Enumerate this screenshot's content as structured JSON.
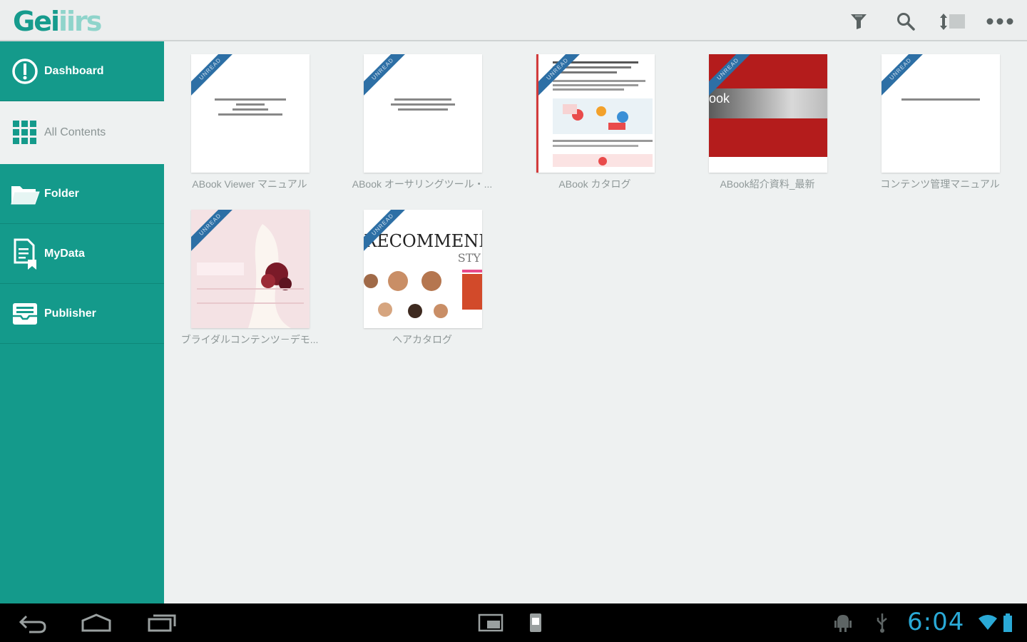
{
  "app": {
    "logo_main": "Gei",
    "logo_fade": "iirs"
  },
  "toolbar": {
    "actions": [
      {
        "name": "filter-icon"
      },
      {
        "name": "search-icon"
      },
      {
        "name": "sort-icon"
      },
      {
        "name": "overflow-menu-icon"
      }
    ]
  },
  "sidebar": {
    "items": [
      {
        "label": "Dashboard",
        "icon": "dashboard-icon"
      },
      {
        "label": "All Contents",
        "icon": "grid-icon",
        "active": true
      },
      {
        "label": "Folder",
        "icon": "folder-icon"
      },
      {
        "label": "MyData",
        "icon": "mydata-icon"
      },
      {
        "label": "Publisher",
        "icon": "publisher-icon"
      }
    ]
  },
  "contents": {
    "ribbon_label": "UNREAD",
    "items": [
      {
        "title": "ABook Viewer マニュアル",
        "thumb": "doc"
      },
      {
        "title": "ABook オーサリングツール・...",
        "thumb": "doc"
      },
      {
        "title": "ABook カタログ",
        "thumb": "catalog"
      },
      {
        "title": "ABook紹介資料_最新",
        "thumb": "red",
        "thumb_text": "ook"
      },
      {
        "title": "コンテンツ管理マニュアル",
        "thumb": "doc"
      },
      {
        "title": "ブライダルコンテンツ－デモ...",
        "thumb": "bridal"
      },
      {
        "title": "ヘアカタログ",
        "thumb": "hair",
        "thumb_text": "RECOMMEND",
        "thumb_sub": "STY"
      }
    ]
  },
  "system_bar": {
    "time": "6:04",
    "accent": "#2aa9d6"
  },
  "colors": {
    "brand": "#149a8b",
    "ribbon": "#2d6fa5"
  }
}
